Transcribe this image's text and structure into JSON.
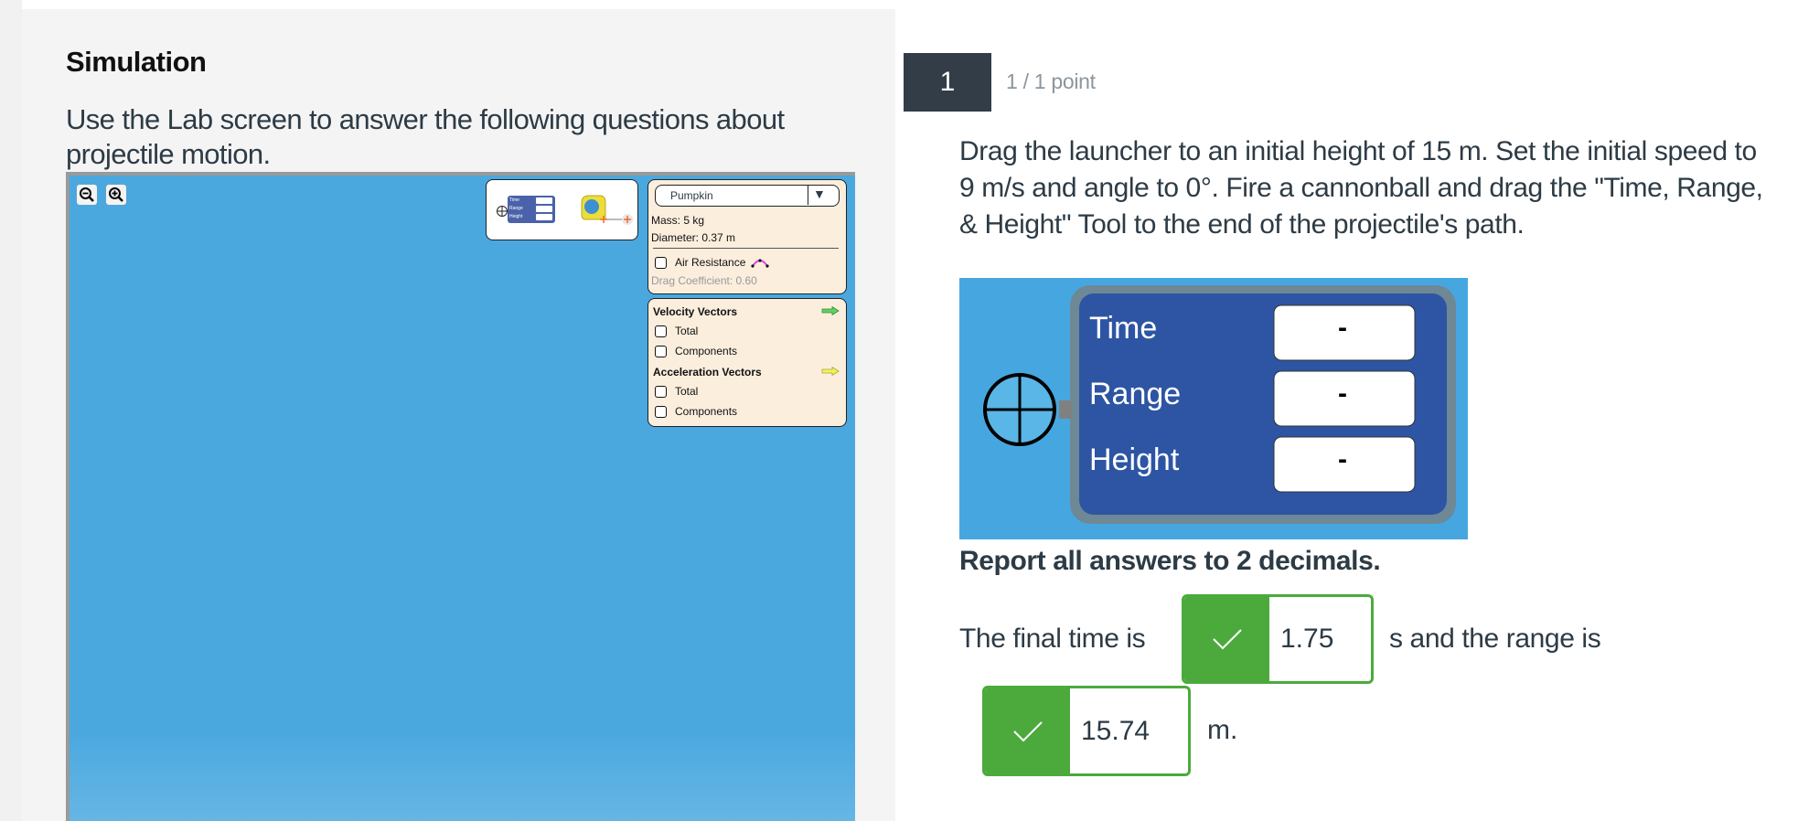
{
  "simulation": {
    "title": "Simulation",
    "description": "Use the Lab screen to answer the following questions about projectile motion.",
    "tools": {
      "mini_tool_labels": [
        "Time",
        "Range",
        "Height"
      ],
      "mini_tool_values": [
        "-",
        "-",
        "-"
      ]
    },
    "projectile_panel": {
      "selected_projectile": "Pumpkin",
      "mass": "Mass: 5 kg",
      "diameter": "Diameter: 0.37 m",
      "air_resistance_label": "Air Resistance",
      "air_resistance_checked": false,
      "drag_coefficient": "Drag Coefficient: 0.60"
    },
    "vectors_panel": {
      "velocity_header": "Velocity Vectors",
      "velocity_total": "Total",
      "velocity_components": "Components",
      "acceleration_header": "Acceleration Vectors",
      "acceleration_total": "Total",
      "acceleration_components": "Components",
      "velocity_arrow_color": "#5fd35f",
      "acceleration_arrow_color": "#f2f25a"
    }
  },
  "question": {
    "number": "1",
    "points": "1 / 1 point",
    "text": "Drag the launcher to an initial height of 15 m. Set the initial speed to 9 m/s and angle to 0°. Fire a cannonball and drag the \"Time, Range, & Height\" Tool to the end of the projectile's path.",
    "tool_image": {
      "labels": [
        "Time",
        "Range",
        "Height"
      ],
      "values": [
        "-",
        "-",
        "-"
      ]
    },
    "instruction": "Report all answers to 2 decimals.",
    "answer_prefix": "The final time is",
    "answer_time": "1.75",
    "answer_mid": "s and the range is",
    "answer_range": "15.74",
    "answer_suffix": "m.",
    "correct_color": "#4caa3c"
  }
}
